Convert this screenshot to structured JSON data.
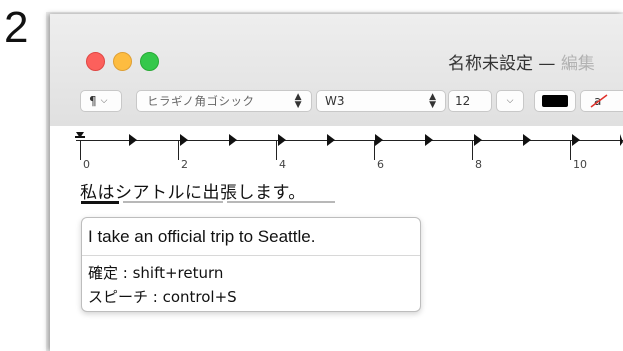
{
  "step_number": "2",
  "window": {
    "title": "名称未設定",
    "title_separator": "—",
    "title_suffix": "編集"
  },
  "toolbar": {
    "paragraph_style_icon": "¶",
    "font_family": "ヒラギノ角ゴシック",
    "font_weight": "W3",
    "font_size": "12",
    "text_color": "#000000",
    "background_color_icon": "a"
  },
  "ruler": {
    "labels": [
      "0",
      "2",
      "4",
      "6",
      "8",
      "10"
    ]
  },
  "document": {
    "text": "私はシアトルに出張します。"
  },
  "conversion_popup": {
    "candidate": "I take an official trip to Seattle.",
    "confirm_hint": "確定 : shift+return",
    "speech_hint": "スピーチ : control+S"
  }
}
